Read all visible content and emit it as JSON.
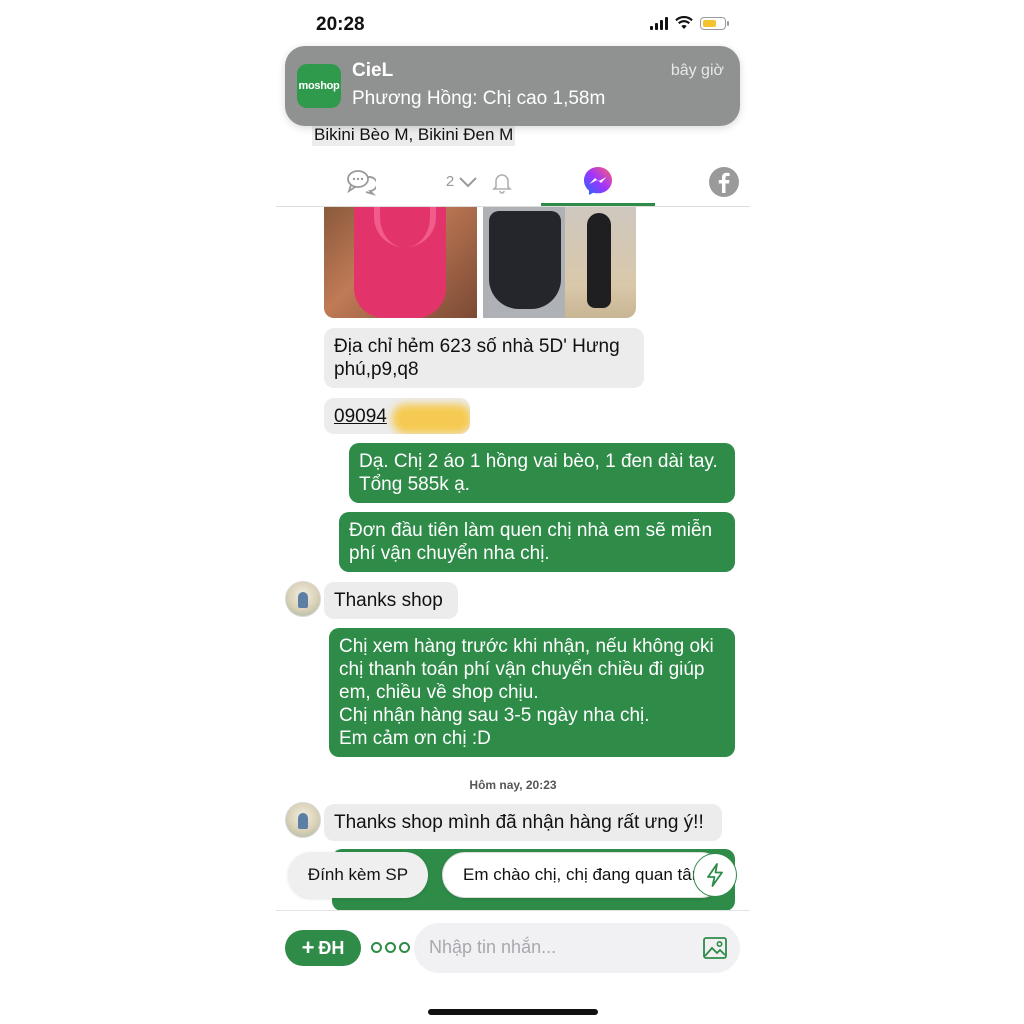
{
  "status_bar": {
    "time": "20:28"
  },
  "notification": {
    "app_icon_label": "moshop",
    "title": "CieL",
    "time": "bây giờ",
    "body": "Phương Hồng: Chị cao 1,58m"
  },
  "order_summary": "Bikini Bèo M, Bikini Đen M",
  "tabs": {
    "chat_icon": "chat-bubbles-icon",
    "notify_count": "2",
    "messenger_icon": "messenger-icon",
    "facebook_icon": "facebook-icon"
  },
  "messages": {
    "address": "Địa chỉ hẻm 623 số nhà 5D' Hưng phú,p9,q8",
    "phone": "09094",
    "order_confirm": "Dạ. Chị 2 áo 1 hồng vai bèo, 1 đen dài tay. Tổng 585k ạ.",
    "free_shipping": "Đơn đầu tiên làm quen chị nhà em sẽ miễn phí vận chuyển nha chị.",
    "thanks": "Thanks shop",
    "policy_line1": "Chị xem hàng trước khi nhận, nếu không oki chị thanh toán phí vận chuyển chiều đi giúp em, chiều về shop chịu.",
    "policy_line2": "Chị nhận hàng sau 3-5 ngày nha chị.",
    "policy_line3": "Em cảm ơn chị :D",
    "timestamp": "Hôm nay, 20:23",
    "received": "Thanks shop mình đã nhận hàng rất ưng ý!!"
  },
  "quick_replies": {
    "attach_product": "Đính kèm SP",
    "greeting": "Em chào chị, chị đang quan tâm"
  },
  "composer": {
    "add_order_label": "ĐH",
    "placeholder": "Nhập tin nhắn..."
  },
  "colors": {
    "brand_green": "#2e8b48",
    "incoming_bubble": "#ececec",
    "notification_bg": "#8f9290"
  }
}
